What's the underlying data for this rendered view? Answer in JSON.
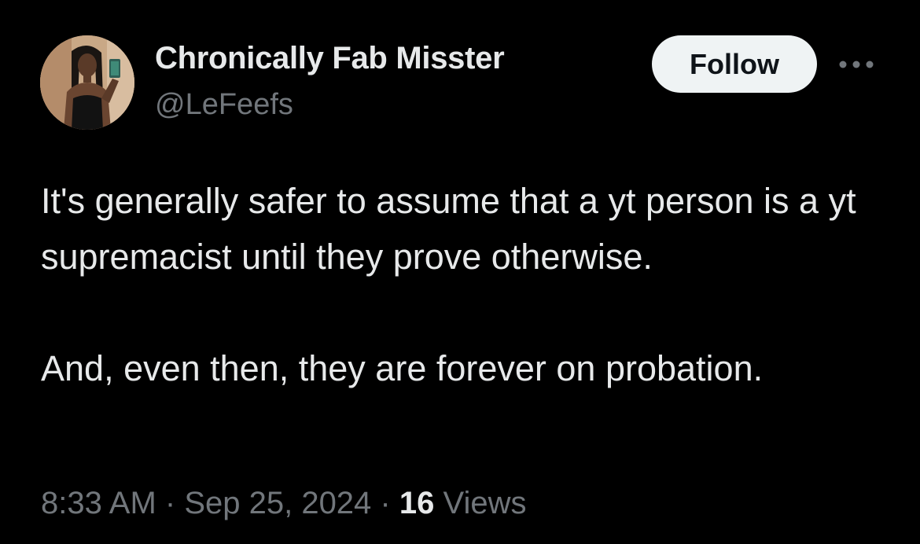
{
  "author": {
    "display_name": "Chronically Fab Misster",
    "handle": "@LeFeefs"
  },
  "actions": {
    "follow_label": "Follow",
    "more_icon": "more-horizontal-icon"
  },
  "tweet": {
    "paragraphs": [
      "It's generally safer to assume that a yt person is a yt supremacist until they prove otherwise.",
      "And, even then, they are forever on probation."
    ]
  },
  "meta": {
    "time": "8:33 AM",
    "separator": " · ",
    "date": "Sep 25, 2024",
    "views_count": "16",
    "views_label": "Views"
  },
  "colors": {
    "background": "#000000",
    "primary_text": "#e7e9ea",
    "secondary_text": "#71767b",
    "follow_button_bg": "#eff3f4"
  }
}
